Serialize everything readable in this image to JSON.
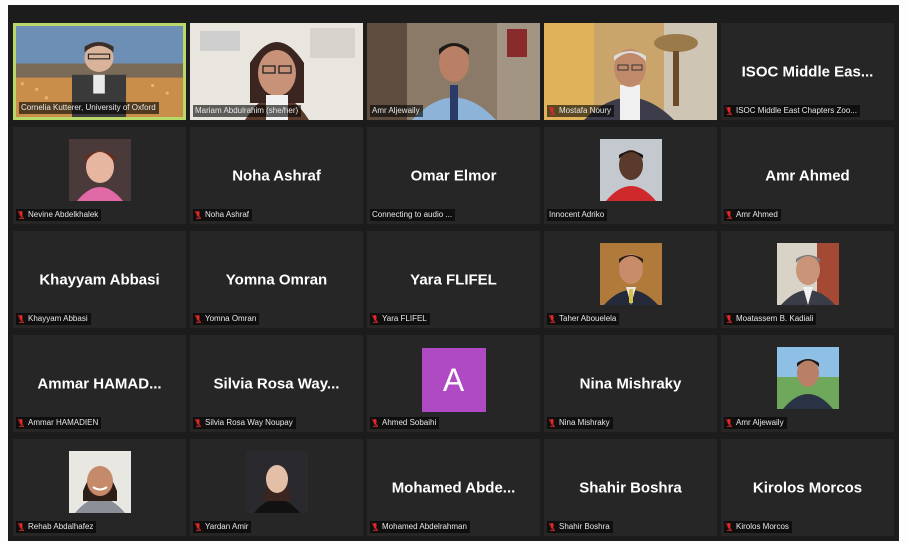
{
  "participants": [
    {
      "label": "Cornelia Kutterer, University of Oxford",
      "kind": "video",
      "scene": "city",
      "mic_muted": false,
      "active": true
    },
    {
      "label": "Mariam Abdulrahim (she/her)",
      "kind": "video",
      "scene": "woman-glasses",
      "mic_muted": false
    },
    {
      "label": "Amr Aljewaily",
      "kind": "video",
      "scene": "man-office",
      "mic_muted": false
    },
    {
      "label": "Mostafa Noury",
      "kind": "video",
      "scene": "older-man",
      "mic_muted": true
    },
    {
      "display_name": "ISOC Middle Eas...",
      "label": "ISOC Middle East Chapters Zoo...",
      "kind": "name",
      "mic_muted": true
    },
    {
      "label": "Nevine Abdelkhalek",
      "kind": "photo",
      "photo": "woman-pink",
      "mic_muted": true
    },
    {
      "display_name": "Noha Ashraf",
      "label": "Noha Ashraf",
      "kind": "name",
      "mic_muted": true
    },
    {
      "display_name": "Omar Elmor",
      "label": "Connecting to audio ...",
      "kind": "name",
      "mic_muted": false
    },
    {
      "label": "Innocent Adriko",
      "kind": "photo",
      "photo": "man-red",
      "mic_muted": false
    },
    {
      "display_name": "Amr Ahmed",
      "label": "Amr Ahmed",
      "kind": "name",
      "mic_muted": true
    },
    {
      "display_name": "Khayyam Abbasi",
      "label": "Khayyam Abbasi",
      "kind": "name",
      "mic_muted": true
    },
    {
      "display_name": "Yomna Omran",
      "label": "Yomna Omran",
      "kind": "name",
      "mic_muted": true
    },
    {
      "display_name": "Yara FLIFEL",
      "label": "Yara FLIFEL",
      "kind": "name",
      "mic_muted": true
    },
    {
      "label": "Taher Abouelela",
      "kind": "photo",
      "photo": "man-suit",
      "mic_muted": true
    },
    {
      "label": "Moatassem B. Kadiali",
      "kind": "photo",
      "photo": "man-suit2",
      "mic_muted": true
    },
    {
      "display_name": "Ammar HAMAD...",
      "label": "Ammar HAMADIEN",
      "kind": "name",
      "mic_muted": true
    },
    {
      "display_name": "Silvia Rosa Way...",
      "label": "Silvia Rosa Way Noupay",
      "kind": "name",
      "mic_muted": true
    },
    {
      "letter": "A",
      "label": "Ahmed Sobaihi",
      "kind": "letter",
      "mic_muted": true
    },
    {
      "display_name": "Nina Mishraky",
      "label": "Nina Mishraky",
      "kind": "name",
      "mic_muted": true
    },
    {
      "label": "Amr Aljewaily",
      "kind": "photo",
      "photo": "man-outdoor",
      "mic_muted": true
    },
    {
      "label": "Rehab Abdalhafez",
      "kind": "photo",
      "photo": "woman-smile",
      "mic_muted": true
    },
    {
      "label": "Yardan Amir",
      "kind": "photo",
      "photo": "woman-dark",
      "mic_muted": true
    },
    {
      "display_name": "Mohamed  Abde...",
      "label": "Mohamed Abdelrahman",
      "kind": "name",
      "mic_muted": true
    },
    {
      "display_name": "Shahir Boshra",
      "label": "Shahir Boshra",
      "kind": "name",
      "mic_muted": true
    },
    {
      "display_name": "Kirolos Morcos",
      "label": "Kirolos Morcos",
      "kind": "name",
      "mic_muted": true
    }
  ],
  "colors": {
    "background": "#1c1c1c",
    "tile": "#262626",
    "active_border": "#b9d86a",
    "mic_muted": "#e02828",
    "letter_avatar": "#b04ac4"
  }
}
